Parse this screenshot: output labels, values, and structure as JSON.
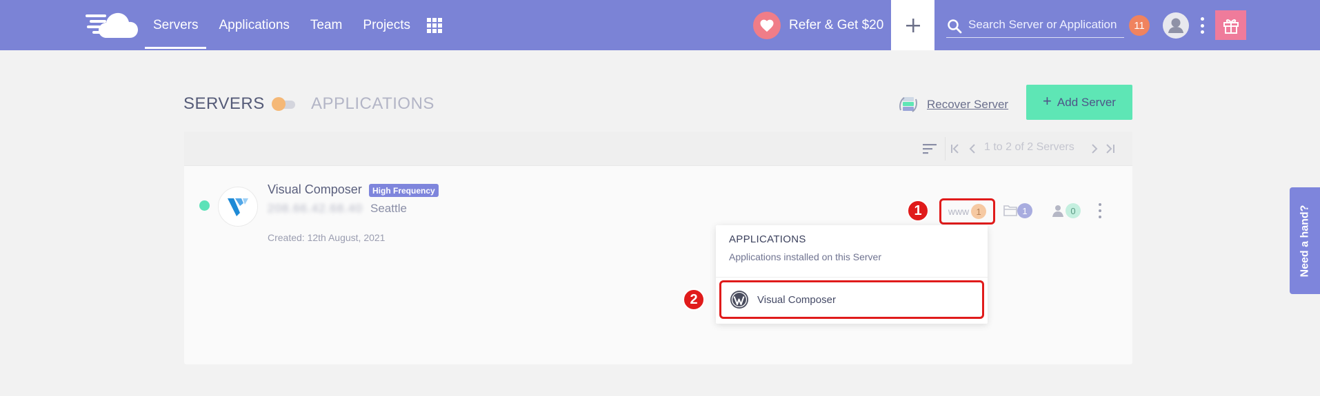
{
  "nav": {
    "items": [
      {
        "label": "Servers"
      },
      {
        "label": "Applications"
      },
      {
        "label": "Team"
      },
      {
        "label": "Projects"
      }
    ]
  },
  "refer": {
    "label": "Refer & Get $20"
  },
  "search": {
    "placeholder": "Search Server or Application"
  },
  "notifications": {
    "count": "11"
  },
  "header": {
    "servers_label": "SERVERS",
    "applications_label": "APPLICATIONS",
    "recover_label": "Recover Server",
    "add_server_label": "Add Server",
    "add_server_plus": "+"
  },
  "pagination": {
    "text": "1 to 2 of 2 Servers"
  },
  "server": {
    "name": "Visual Composer",
    "badge": "High Frequency",
    "ip": "208.66.42.68.40",
    "location": "Seattle",
    "created": "Created: 12th August, 2021",
    "www_label": "www",
    "apps_count": "1",
    "files_count": "1",
    "users_count": "0"
  },
  "callouts": [
    "1",
    "2"
  ],
  "dropdown": {
    "title": "APPLICATIONS",
    "subtitle": "Applications installed on this Server",
    "items": [
      {
        "label": "Visual Composer",
        "icon": "wordpress-icon"
      }
    ]
  },
  "help": {
    "label": "Need a hand?"
  },
  "colors": {
    "topbar": "#7b83d6",
    "accent_green": "#5ee6b5",
    "callout_red": "#e01b1b",
    "refer_pink": "#f07d88",
    "gift_pink": "#ef7b9b",
    "notif_orange": "#f0835f"
  }
}
